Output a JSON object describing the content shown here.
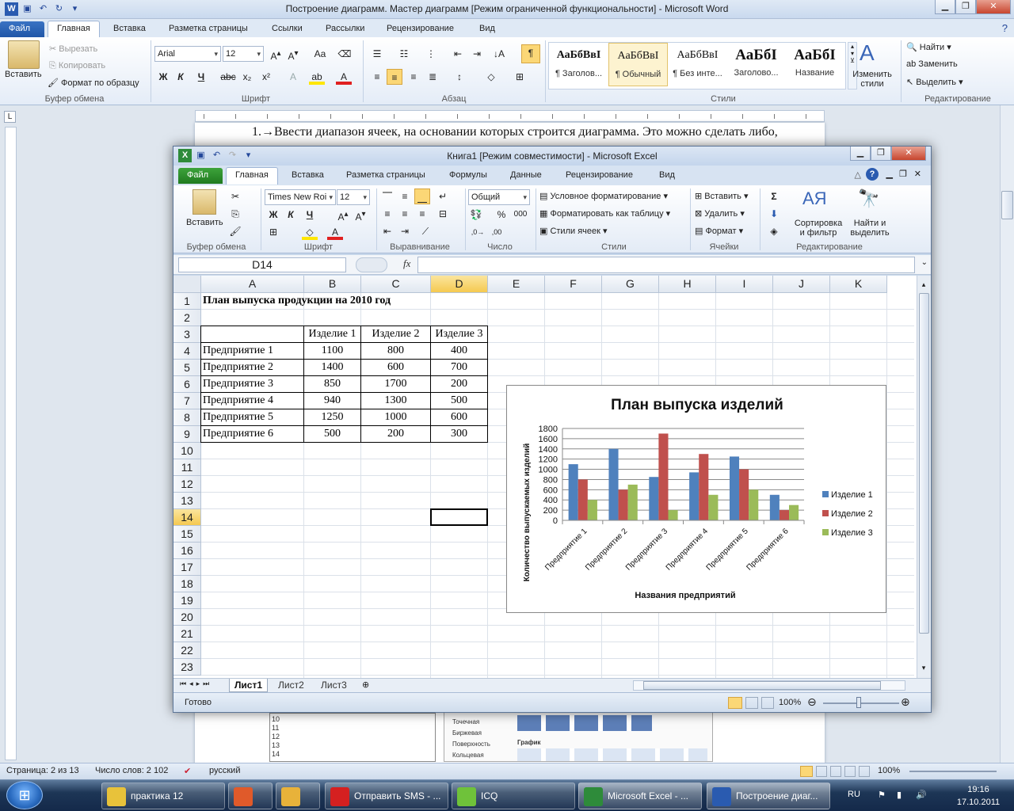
{
  "word": {
    "title": "Построение диаграмм. Мастер диаграмм [Режим ограниченной функциональности]  -  Microsoft Word",
    "tabs": [
      "Файл",
      "Главная",
      "Вставка",
      "Разметка страницы",
      "Ссылки",
      "Рассылки",
      "Рецензирование",
      "Вид"
    ],
    "clipboard": {
      "paste": "Вставить",
      "cut": "Вырезать",
      "copy": "Копировать",
      "format": "Формат по образцу",
      "label": "Буфер обмена"
    },
    "font": {
      "name": "Arial",
      "size": "12",
      "label": "Шрифт"
    },
    "paragraph_label": "Абзац",
    "styles": [
      {
        "sample": "АаБбВвІ",
        "name": "¶ Заголов..."
      },
      {
        "sample": "АаБбВвІ",
        "name": "¶ Обычный"
      },
      {
        "sample": "АаБбВвІ",
        "name": "¶ Без инте..."
      },
      {
        "sample": "АаБбІ",
        "name": "Заголово..."
      },
      {
        "sample": "АаБбІ",
        "name": "Название"
      }
    ],
    "change_styles": "Изменить стили",
    "styles_label": "Стили",
    "editing": {
      "find": "Найти",
      "replace": "Заменить",
      "select": "Выделить",
      "label": "Редактирование"
    },
    "doc_line": "1.→Ввести диапазон ячеек, на основании которых строится диаграмма. Это можно сделать либо,",
    "fragment_rows": [
      "10",
      "11",
      "12",
      "13",
      "14"
    ],
    "fragment_items": [
      "Точечная",
      "Биржевая",
      "Поверхность",
      "Кольцевая"
    ],
    "fragment_graph": "График",
    "status": {
      "page": "Страница: 2 из 13",
      "words": "Число слов: 2 102",
      "lang": "русский",
      "zoom": "100%"
    }
  },
  "excel": {
    "title": "Книга1  [Режим совместимости]  -  Microsoft Excel",
    "tabs": [
      "Файл",
      "Главная",
      "Вставка",
      "Разметка страницы",
      "Формулы",
      "Данные",
      "Рецензирование",
      "Вид"
    ],
    "clipboard": {
      "paste": "Вставить",
      "label": "Буфер обмена"
    },
    "font": {
      "name": "Times New Roi",
      "size": "12",
      "label": "Шрифт"
    },
    "align_label": "Выравнивание",
    "number": {
      "format": "Общий",
      "label": "Число"
    },
    "styles": {
      "cond": "Условное форматирование",
      "table": "Форматировать как таблицу",
      "cell": "Стили ячеек",
      "label": "Стили"
    },
    "cells": {
      "insert": "Вставить",
      "delete": "Удалить",
      "format": "Формат",
      "label": "Ячейки"
    },
    "editing": {
      "sort": "Сортировка и фильтр",
      "find": "Найти и выделить",
      "label": "Редактирование"
    },
    "namebox": "D14",
    "fx": "fx",
    "columns": [
      "A",
      "B",
      "C",
      "D",
      "E",
      "F",
      "G",
      "H",
      "I",
      "J",
      "K"
    ],
    "rows": [
      "1",
      "2",
      "3",
      "4",
      "5",
      "6",
      "7",
      "8",
      "9",
      "10",
      "11",
      "12",
      "13",
      "14",
      "15",
      "16",
      "17",
      "18",
      "19",
      "20",
      "21",
      "22",
      "23"
    ],
    "sheet_title": "План выпуска продукции на 2010 год",
    "table": {
      "headers": [
        "Изделие 1",
        "Изделие 2",
        "Изделие 3"
      ],
      "rows": [
        {
          "name": "Предприятие 1",
          "v": [
            "1100",
            "800",
            "400"
          ]
        },
        {
          "name": "Предприятие 2",
          "v": [
            "1400",
            "600",
            "700"
          ]
        },
        {
          "name": "Предприятие 3",
          "v": [
            "850",
            "1700",
            "200"
          ]
        },
        {
          "name": "Предприятие 4",
          "v": [
            "940",
            "1300",
            "500"
          ]
        },
        {
          "name": "Предприятие 5",
          "v": [
            "1250",
            "1000",
            "600"
          ]
        },
        {
          "name": "Предприятие 6",
          "v": [
            "500",
            "200",
            "300"
          ]
        }
      ]
    },
    "sheets": [
      "Лист1",
      "Лист2",
      "Лист3"
    ],
    "status": {
      "ready": "Готово",
      "zoom": "100%"
    }
  },
  "chart_data": {
    "type": "bar",
    "title": "План выпуска изделий",
    "xlabel": "Названия  предприятий",
    "ylabel": "Количество  выпускаемых  изделий",
    "categories": [
      "Предприятие  1",
      "Предприятие  2",
      "Предприятие  3",
      "Предприятие  4",
      "Предприятие  5",
      "Предприятие  6"
    ],
    "series": [
      {
        "name": "Изделие  1",
        "color": "#4f81bd",
        "values": [
          1100,
          1400,
          850,
          940,
          1250,
          500
        ]
      },
      {
        "name": "Изделие  2",
        "color": "#c0504d",
        "values": [
          800,
          600,
          1700,
          1300,
          1000,
          200
        ]
      },
      {
        "name": "Изделие  3",
        "color": "#9bbb59",
        "values": [
          400,
          700,
          200,
          500,
          600,
          300
        ]
      }
    ],
    "ylim": [
      0,
      1800
    ],
    "yticks": [
      "0",
      "200",
      "400",
      "600",
      "800",
      "1000",
      "1200",
      "1400",
      "1600",
      "1800"
    ],
    "grid": true,
    "legend": "right"
  },
  "taskbar": {
    "items": [
      {
        "label": "практика 12",
        "color": "#e8c23a"
      },
      {
        "label": "",
        "color": "#e05a2a"
      },
      {
        "label": "",
        "color": "#e8b23a"
      },
      {
        "label": "Отправить SMS - ...",
        "color": "#d52020"
      },
      {
        "label": "ICQ",
        "color": "#6fc23a"
      },
      {
        "label": "Microsoft Excel - ...",
        "color": "#2e8b3a"
      },
      {
        "label": "Построение диаг...",
        "color": "#2a5bb0"
      }
    ],
    "lang": "RU",
    "time": "19:16",
    "date": "17.10.2011"
  }
}
